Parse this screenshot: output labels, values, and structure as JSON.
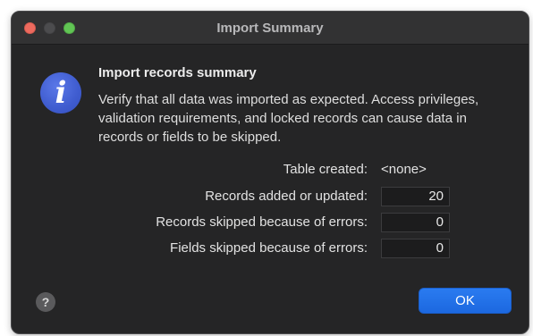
{
  "window": {
    "title": "Import Summary"
  },
  "icon": {
    "name": "info-icon",
    "glyph": "i",
    "color": "#3f5ccf"
  },
  "dialog": {
    "heading": "Import records summary",
    "message": "Verify that all data was imported as expected. Access privileges, validation requirements, and locked records can cause data in records or fields to be skipped."
  },
  "summary": {
    "table_created_label": "Table created:",
    "table_created_value": "<none>",
    "records_added_label": "Records added or updated:",
    "records_added_value": "20",
    "records_skipped_label": "Records skipped because of errors:",
    "records_skipped_value": "0",
    "fields_skipped_label": "Fields skipped because of errors:",
    "fields_skipped_value": "0"
  },
  "buttons": {
    "help_glyph": "?",
    "ok_label": "OK"
  },
  "colors": {
    "accent": "#1c68e0",
    "window_bg": "#252526",
    "close": "#ed6a5e",
    "maximize": "#61c554"
  }
}
